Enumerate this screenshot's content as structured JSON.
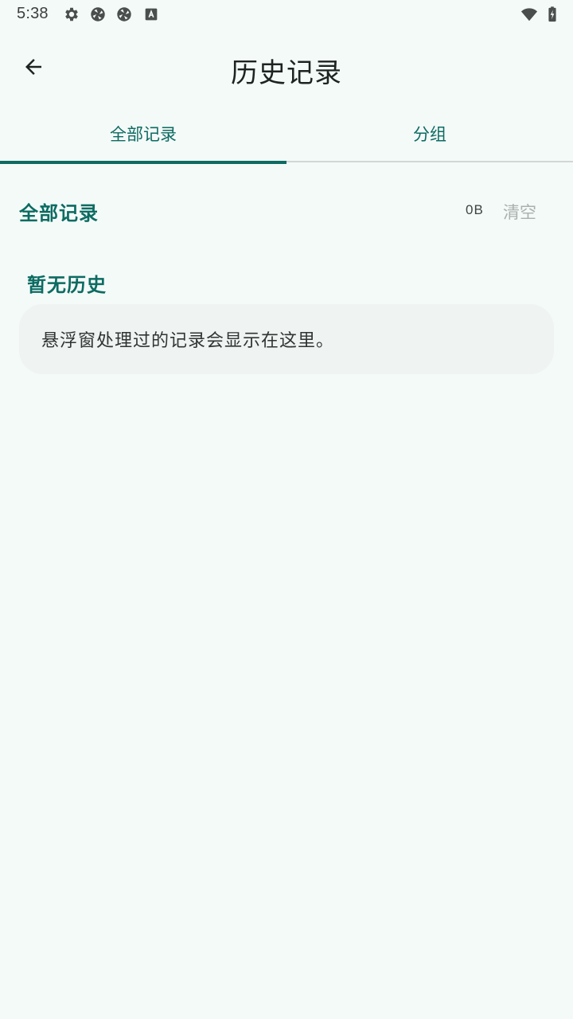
{
  "status_bar": {
    "time": "5:38",
    "icons": [
      "settings-icon",
      "sync-icon",
      "sync-icon",
      "text-recognition-icon",
      "wifi-icon",
      "battery-charging-icon"
    ]
  },
  "app_bar": {
    "title": "历史记录",
    "back_icon": "arrow-back-icon"
  },
  "tabs": [
    {
      "label": "全部记录",
      "selected": true
    },
    {
      "label": "分组",
      "selected": false
    }
  ],
  "section": {
    "title": "全部记录",
    "size": "0B",
    "clear_label": "清空"
  },
  "empty_state": {
    "title": "暂无历史",
    "message": "悬浮窗处理过的记录会显示在这里。"
  },
  "colors": {
    "background": "#f4faf8",
    "accent": "#0c6b62",
    "card": "#eff3f2",
    "muted": "#a9b0ae"
  }
}
